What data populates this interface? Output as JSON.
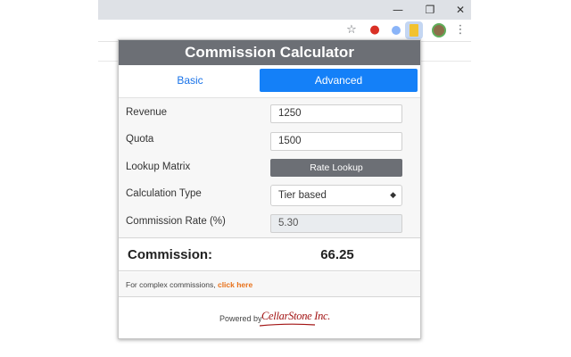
{
  "browser": {
    "window_controls": {
      "minimize": "—",
      "restore": "❐",
      "close": "✕"
    },
    "toolbar_icons": [
      "star-icon",
      "red-extension-icon",
      "blue-dot-extension-icon",
      "commission-calculator-extension-icon",
      "profile-avatar-icon",
      "menu-kebab-icon"
    ],
    "star_glyph": "☆",
    "menu_glyph": "⋮"
  },
  "popup": {
    "title": "Commission Calculator",
    "tabs": [
      {
        "label": "Basic",
        "active": false
      },
      {
        "label": "Advanced",
        "active": true
      }
    ],
    "form": {
      "revenue": {
        "label": "Revenue",
        "value": "1250"
      },
      "quota": {
        "label": "Quota",
        "value": "1500"
      },
      "lookup_matrix": {
        "label": "Lookup Matrix",
        "button_label": "Rate Lookup"
      },
      "calculation_type": {
        "label": "Calculation Type",
        "selected": "Tier based"
      },
      "commission_rate": {
        "label": "Commission Rate (%)",
        "value": "5.30"
      }
    },
    "result": {
      "label": "Commission:",
      "value": "66.25"
    },
    "note": {
      "text": "For complex commissions, ",
      "link_text": "click here"
    },
    "footer": {
      "powered_by": "Powered by",
      "brand": "CellarStone Inc."
    }
  },
  "colors": {
    "header_bg": "#6c6f75",
    "active_tab_bg": "#1480f8",
    "link_blue": "#1a73e8",
    "link_orange": "#e8711a",
    "brand_red": "#a31515"
  }
}
